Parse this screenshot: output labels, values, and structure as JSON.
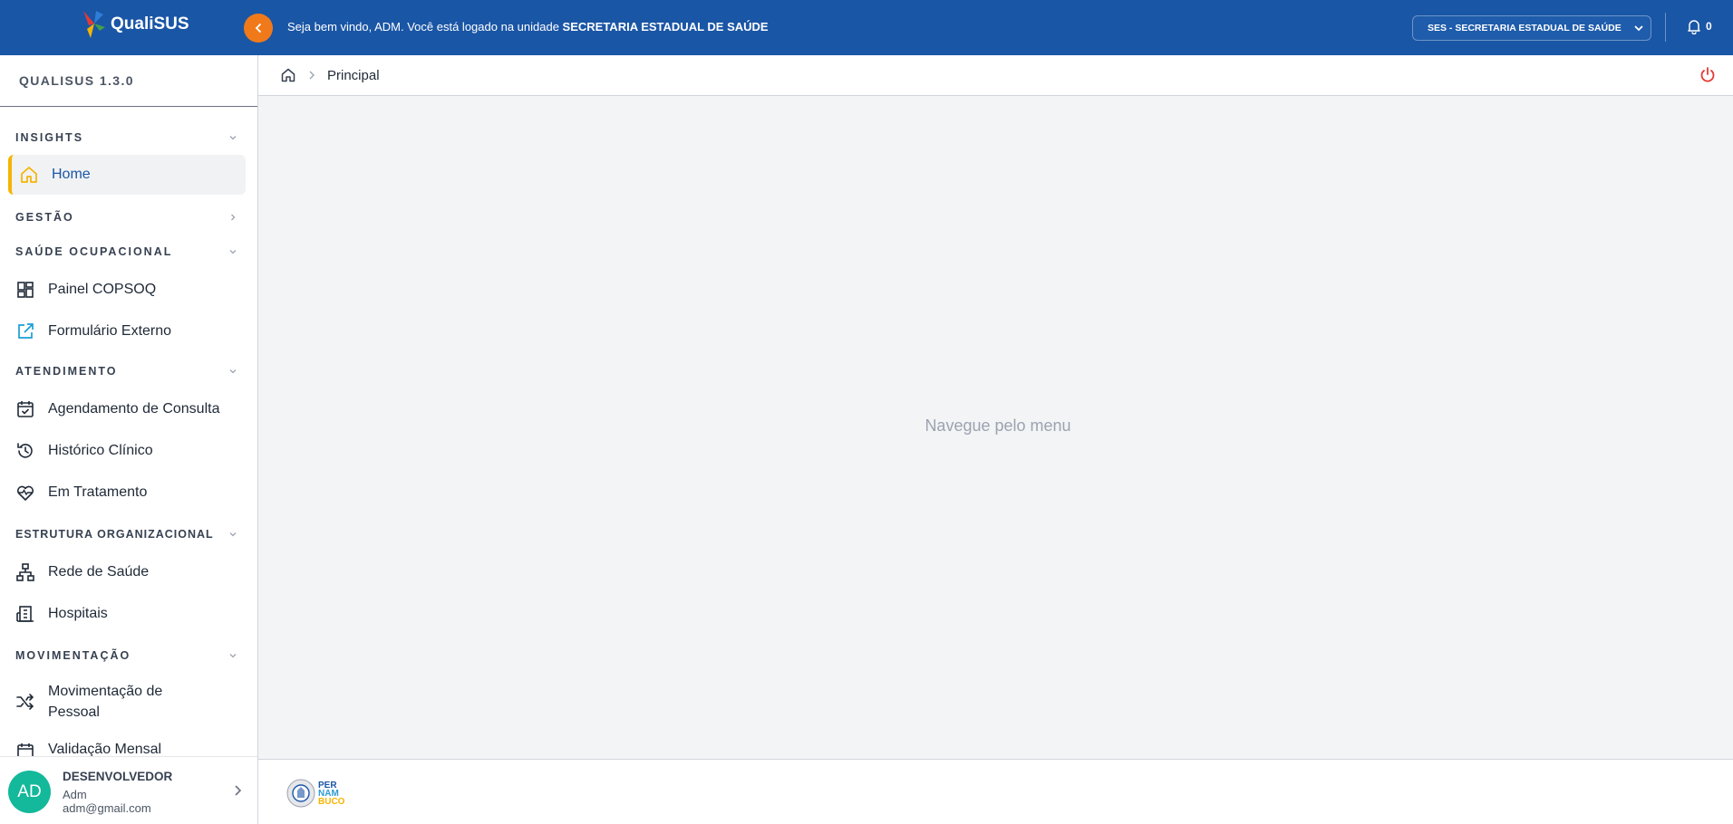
{
  "header": {
    "app_name": "QualiSUS",
    "welcome_prefix": "Seja bem vindo, ADM. Você está logado na unidade ",
    "welcome_unit": "SECRETARIA ESTADUAL DE SAÚDE",
    "unit_select_value": "SES - SECRETARIA ESTADUAL DE SAÚDE",
    "notification_count": "0",
    "brand_color": "#1a56a6",
    "accent_color": "#f07a1a"
  },
  "sidebar": {
    "version": "QUALISUS 1.3.0",
    "sections": {
      "insights": "INSIGHTS",
      "gestao": "GESTÃO",
      "saude_ocupacional": "SAÚDE OCUPACIONAL",
      "atendimento": "ATENDIMENTO",
      "estrutura": "ESTRUTURA ORGANIZACIONAL",
      "movimentacao": "MOVIMENTAÇÃO"
    },
    "items": {
      "home": "Home",
      "painel_copsoq": "Painel COPSOQ",
      "formulario_externo": "Formulário Externo",
      "agendamento": "Agendamento de Consulta",
      "historico": "Histórico Clínico",
      "em_tratamento": "Em Tratamento",
      "rede_saude": "Rede de Saúde",
      "hospitais": "Hospitais",
      "movimentacao_pessoal_1": "Movimentação de",
      "movimentacao_pessoal_2": "Pessoal",
      "validacao_mensal": "Validação Mensal"
    },
    "user": {
      "initials": "AD",
      "role": "DESENVOLVEDOR",
      "name": "Adm",
      "email": "adm@gmail.com"
    }
  },
  "main": {
    "breadcrumb_current": "Principal",
    "empty_message": "Navegue pelo menu"
  },
  "footer": {
    "logo_line1": "PER",
    "logo_line2": "NAM",
    "logo_line3": "BUCO"
  }
}
